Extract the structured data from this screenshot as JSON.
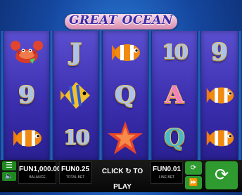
{
  "title": "GREAT OCEAN",
  "reels": [
    {
      "symbols": [
        "crab",
        "nine",
        "clownfish"
      ]
    },
    {
      "symbols": [
        "J",
        "angelfish",
        "ten"
      ]
    },
    {
      "symbols": [
        "clownfish",
        "Q",
        "starfish"
      ]
    },
    {
      "symbols": [
        "ten",
        "A",
        "Q"
      ]
    },
    {
      "symbols": [
        "nine",
        "clownfish",
        "clownfish"
      ]
    }
  ],
  "labels": {
    "nine": "9",
    "ten": "10",
    "J": "J",
    "Q": "Q",
    "A": "A"
  },
  "bottom": {
    "balance_value": "FUN1,000.00",
    "balance_label": "BALANCE",
    "total_bet_value": "FUN0.25",
    "total_bet_label": "TOTAL BET",
    "play_text": "CLICK",
    "play_text2": "TO PLAY",
    "line_bet_value": "FUN0.01",
    "line_bet_label": "LINE BET"
  },
  "icons": {
    "menu": "hamburger-menu-icon",
    "sound": "speaker-icon",
    "autoplay": "autoplay-icon",
    "turbo": "fast-forward-icon",
    "spin": "spin-arrow-icon"
  },
  "colors": {
    "ocean": "#15479f",
    "reel": "#4a3fc2",
    "button": "#2f9a2f"
  }
}
